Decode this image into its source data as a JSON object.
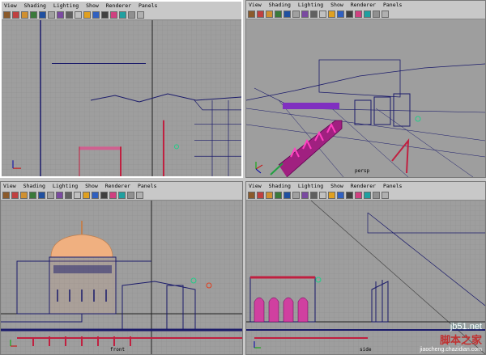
{
  "menu_items": [
    "View",
    "Shading",
    "Lighting",
    "Show",
    "Renderer",
    "Panels"
  ],
  "toolbar_colors": [
    "#8b5a2b",
    "#c04040",
    "#d09030",
    "#3a7a3a",
    "#2050a0",
    "#a0a0a0",
    "#7a4aa0",
    "#606060",
    "#c0c0c0",
    "#e0a020",
    "#3060c0",
    "#404040",
    "#d04080",
    "#20a0a0",
    "#909090",
    "#b0b0b0"
  ],
  "viewports": {
    "top": {
      "camera": ""
    },
    "persp": {
      "camera": "persp"
    },
    "front": {
      "camera": "front"
    },
    "side": {
      "camera": "side"
    }
  },
  "watermark": {
    "site": "jb51.net",
    "brand": "脚本之家",
    "sub": "jiaocheng.chazidian.com"
  },
  "icons": {
    "axis": "axis-gizmo-icon",
    "light": "light-icon",
    "locator": "locator-icon"
  }
}
